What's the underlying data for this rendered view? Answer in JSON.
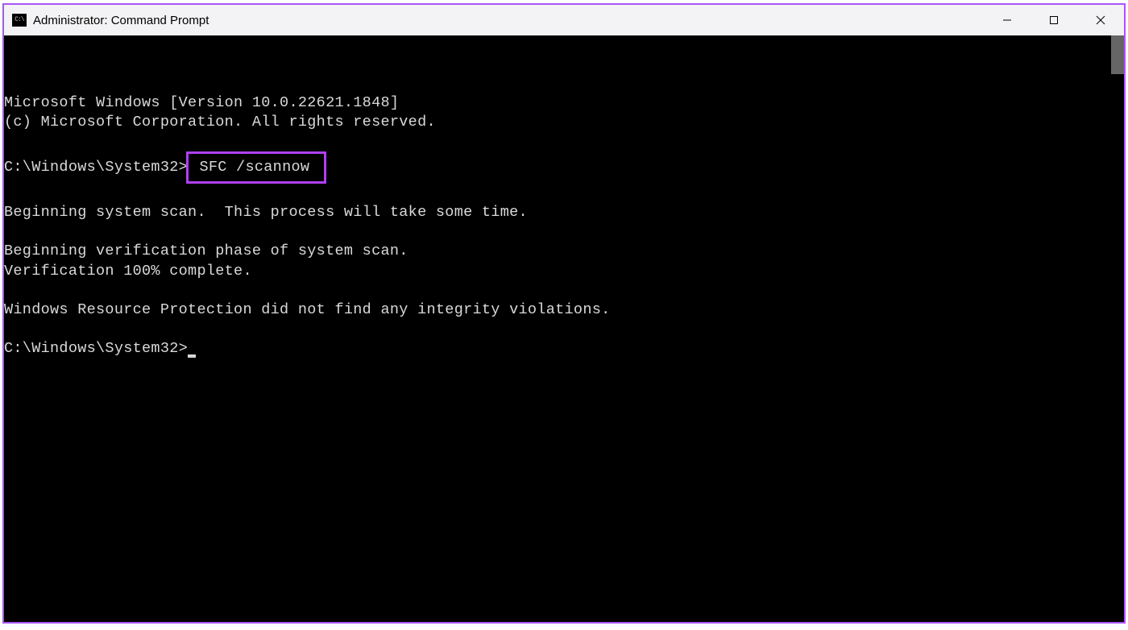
{
  "window": {
    "title": "Administrator: Command Prompt",
    "icon_text": "C:\\"
  },
  "terminal": {
    "line1": "Microsoft Windows [Version 10.0.22621.1848]",
    "line2": "(c) Microsoft Corporation. All rights reserved.",
    "prompt1_path": "C:\\Windows\\System32>",
    "prompt1_cmd": "SFC /scannow",
    "line3": "Beginning system scan.  This process will take some time.",
    "line4": "Beginning verification phase of system scan.",
    "line5": "Verification 100% complete.",
    "line6": "Windows Resource Protection did not find any integrity violations.",
    "prompt2_path": "C:\\Windows\\System32>"
  },
  "annotation": {
    "highlight_color": "#b040f0"
  }
}
